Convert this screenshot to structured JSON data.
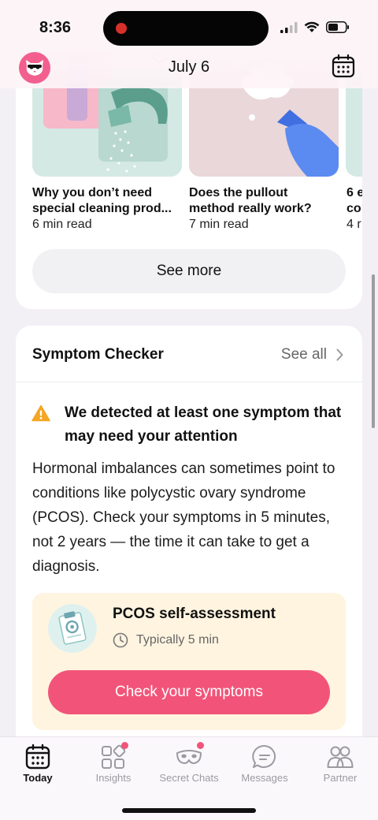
{
  "status_bar": {
    "time": "8:36"
  },
  "header": {
    "title": "July 6"
  },
  "articles": {
    "items": [
      {
        "title_line1": "Why you don’t need",
        "title_line2": "special cleaning prod...",
        "meta": "6 min read"
      },
      {
        "title_line1": "Does the pullout",
        "title_line2": "method really work?",
        "meta": "7 min read"
      },
      {
        "title_line1": "6 e",
        "title_line2": "co",
        "meta": "4 r"
      }
    ],
    "see_more_label": "See more"
  },
  "symptom_checker": {
    "title": "Symptom Checker",
    "see_all_label": "See all",
    "warning_text": "We detected at least one symptom that may need your attention",
    "body": "Hormonal imbalances can sometimes point to conditions like polycystic ovary syndrome (PCOS). Check your symptoms in 5 minutes, not 2 years — the time it can take to get a diagnosis.",
    "assessment": {
      "title": "PCOS self-assessment",
      "duration": "Typically 5 min",
      "cta_label": "Check your symptoms"
    }
  },
  "tab_bar": {
    "tabs": [
      {
        "label": "Today",
        "icon": "calendar-icon",
        "active": true
      },
      {
        "label": "Insights",
        "icon": "insights-grid-icon",
        "badge": true
      },
      {
        "label": "Secret Chats",
        "icon": "mask-icon",
        "badge": true
      },
      {
        "label": "Messages",
        "icon": "chat-bubble-icon"
      },
      {
        "label": "Partner",
        "icon": "partner-icon"
      }
    ]
  },
  "colors": {
    "accent": "#f25479",
    "avatar": "#f25f8e",
    "assessment_bg": "#fff4e0",
    "warning": "#f5a623"
  }
}
